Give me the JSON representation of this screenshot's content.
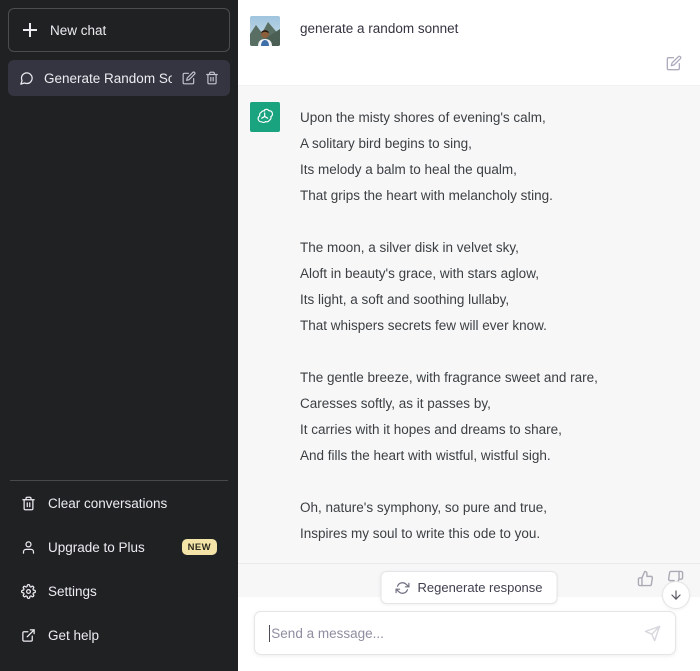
{
  "sidebar": {
    "new_chat_label": "New chat",
    "conversation": {
      "title": "Generate Random Son",
      "edit_tooltip": "Edit",
      "delete_tooltip": "Delete"
    },
    "footer": [
      {
        "label": "Clear conversations",
        "icon": "trash-icon",
        "badge": ""
      },
      {
        "label": "Upgrade to Plus",
        "icon": "user-icon",
        "badge": "NEW"
      },
      {
        "label": "Settings",
        "icon": "gear-icon",
        "badge": ""
      },
      {
        "label": "Get help",
        "icon": "external-link-icon",
        "badge": ""
      }
    ]
  },
  "conversation": {
    "user_message": "generate a random sonnet",
    "assistant_message_lines": [
      "Upon the misty shores of evening's calm,",
      "A solitary bird begins to sing,",
      "Its melody a balm to heal the qualm,",
      "That grips the heart with melancholy sting.",
      "",
      "The moon, a silver disk in velvet sky,",
      "Aloft in beauty's grace, with stars aglow,",
      "Its light, a soft and soothing lullaby,",
      "That whispers secrets few will ever know.",
      "",
      "The gentle breeze, with fragrance sweet and rare,",
      "Caresses softly, as it passes by,",
      "It carries with it hopes and dreams to share,",
      "And fills the heart with wistful, wistful sigh.",
      "",
      "Oh, nature's symphony, so pure and true,",
      "Inspires my soul to write this ode to you."
    ]
  },
  "actions": {
    "regenerate_label": "Regenerate response",
    "thumbs_up": "thumbs-up-icon",
    "thumbs_down": "thumbs-down-icon",
    "scroll_down": "arrow-down-icon",
    "edit_message": "edit-square-icon"
  },
  "composer": {
    "placeholder": "Send a message...",
    "value": "",
    "send_icon": "send-plane-icon"
  },
  "colors": {
    "sidebar_bg": "#202123",
    "sidebar_active": "#343541",
    "assistant_bg": "#f7f7f8",
    "user_bg": "#ffffff",
    "openai_green": "#10a37f",
    "badge_bg": "#f5e4a8",
    "text_primary": "#ececf1"
  }
}
